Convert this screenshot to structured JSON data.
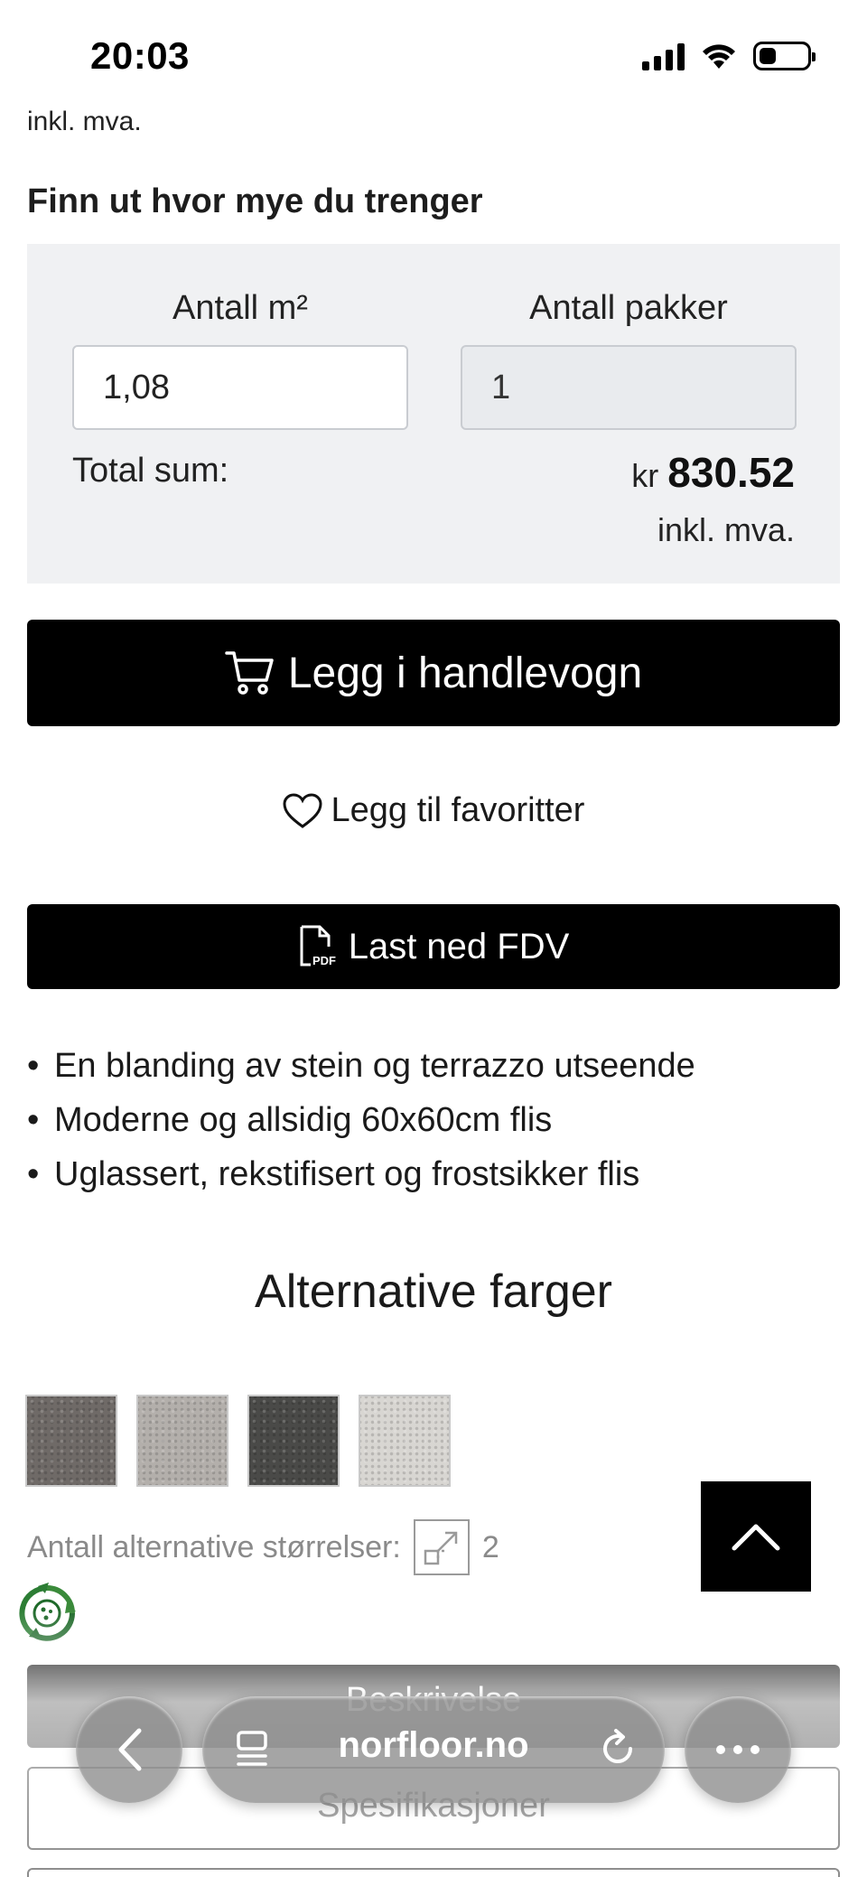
{
  "status_bar": {
    "time": "20:03",
    "icons": [
      "signal-icon",
      "wifi-icon",
      "battery-icon"
    ],
    "battery_level": 0.35
  },
  "price_suffix_top": "inkl. mva.",
  "calculator": {
    "heading": "Finn ut hvor mye du trenger",
    "area_label": "Antall m²",
    "area_value": "1,08",
    "packs_label": "Antall pakker",
    "packs_value": "1",
    "total_label": "Total sum:",
    "currency": "kr",
    "total_amount": "830.52",
    "vat_note": "inkl. mva."
  },
  "actions": {
    "add_to_cart": "Legg i handlevogn",
    "add_to_favorites": "Legg til favoritter",
    "download_fdv": "Last ned FDV",
    "pdf_badge": "PDF"
  },
  "features": [
    "En blanding av stein og terrazzo utseende",
    "Moderne og allsidig 60x60cm flis",
    "Uglassert, rekstifisert og frostsikker flis"
  ],
  "alternatives": {
    "heading": "Alternative farger",
    "swatches": [
      {
        "color": "#6f6a67"
      },
      {
        "color": "#b3afab"
      },
      {
        "color": "#4a4a48"
      },
      {
        "color": "#d8d6d2"
      }
    ],
    "sizes_label": "Antall alternative størrelser:",
    "sizes_count": "2"
  },
  "below_fold": {
    "description_button": "Beskrivelse",
    "specifications_button": "Spesifikasjoner"
  },
  "browser": {
    "url": "norfloor.no"
  },
  "colors": {
    "button_bg": "#000000",
    "calc_bg": "#f0f1f3",
    "text": "#1a1a1a"
  }
}
